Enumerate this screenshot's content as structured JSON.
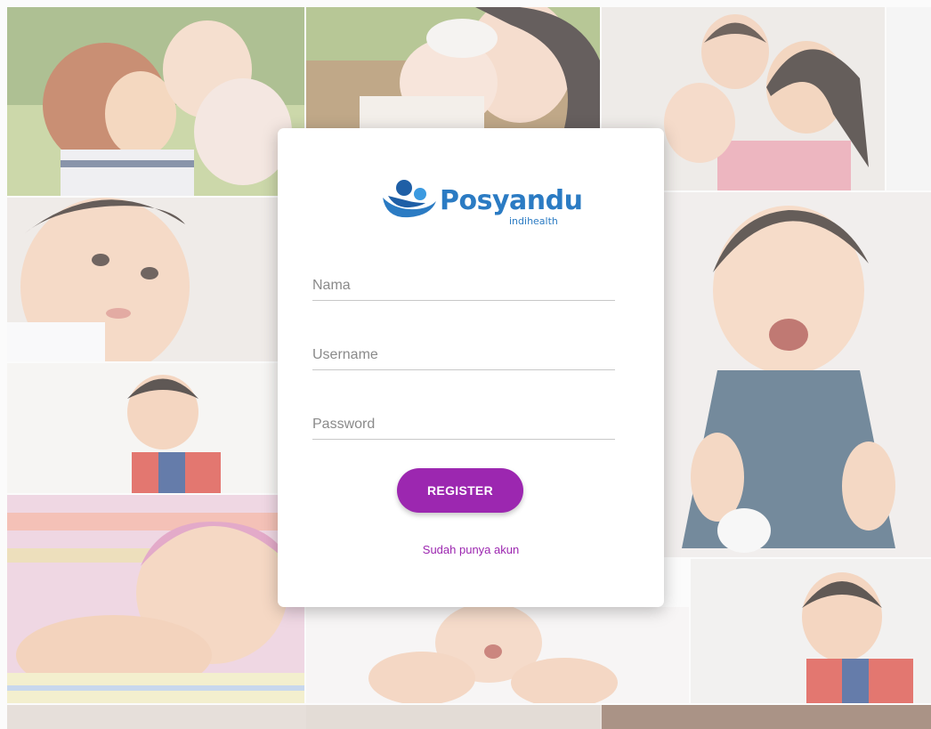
{
  "brand": {
    "name": "Posyandu",
    "tagline": "indihealth",
    "logo_icon": "people-embrace-icon",
    "color": "#2b7bc3"
  },
  "form": {
    "nama_placeholder": "Nama",
    "username_placeholder": "Username",
    "password_placeholder": "Password",
    "submit_label": "REGISTER",
    "login_link": "Sudah punya akun"
  },
  "colors": {
    "accent": "#9c27b0",
    "card": "#ffffff"
  },
  "background": {
    "description_icon": "baby-photo-collage"
  }
}
